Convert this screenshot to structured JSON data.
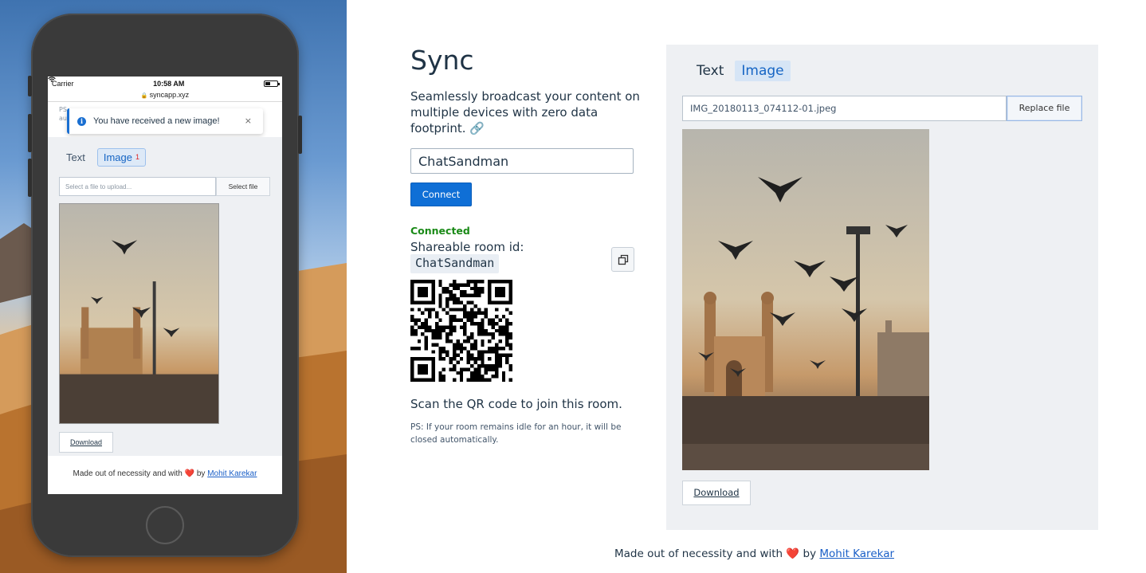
{
  "phone": {
    "status": {
      "carrier": "Carrier",
      "time": "10:58 AM"
    },
    "url": "syncapp.xyz",
    "ps_fragment": "PS au",
    "toast": {
      "message": "You have received a new image!",
      "close": "×"
    },
    "tabs": [
      {
        "label": "Text"
      },
      {
        "label": "Image",
        "badge": "1"
      }
    ],
    "file_placeholder": "Select a file to upload...",
    "select_label": "Select file",
    "download_label": "Download",
    "footer": {
      "text": "Made out of necessity and with",
      "heart": "❤️",
      "by": "by",
      "author": "Mohit Karekar"
    }
  },
  "app": {
    "title": "Sync",
    "tagline": "Seamlessly broadcast your content on multiple devices with zero data footprint. 🔗",
    "room_input_value": "ChatSandman",
    "connect_label": "Connect",
    "status": "Connected",
    "share_label": "Shareable room id:",
    "room_id": "ChatSandman",
    "scan_text": "Scan the QR code to join this room.",
    "ps_note": "PS: If your room remains idle for an hour, it will be closed automatically."
  },
  "panel": {
    "tabs": [
      {
        "label": "Text"
      },
      {
        "label": "Image"
      }
    ],
    "file_name": "IMG_20180113_074112-01.jpeg",
    "replace_label": "Replace file",
    "download_label": "Download"
  },
  "footer": {
    "text": "Made out of necessity and with",
    "heart": "❤️",
    "by": "by",
    "author": "Mohit Karekar"
  },
  "colors": {
    "accent": "#0f6fd6",
    "connected": "#1a8a17",
    "card_bg": "#eef0f3",
    "link": "#1a5fc7",
    "heart": "#e3111c"
  },
  "icons": {
    "copy": "copy-icon",
    "info": "info-icon",
    "lock": "lock-icon",
    "wifi": "wifi-icon",
    "link": "link-icon"
  }
}
